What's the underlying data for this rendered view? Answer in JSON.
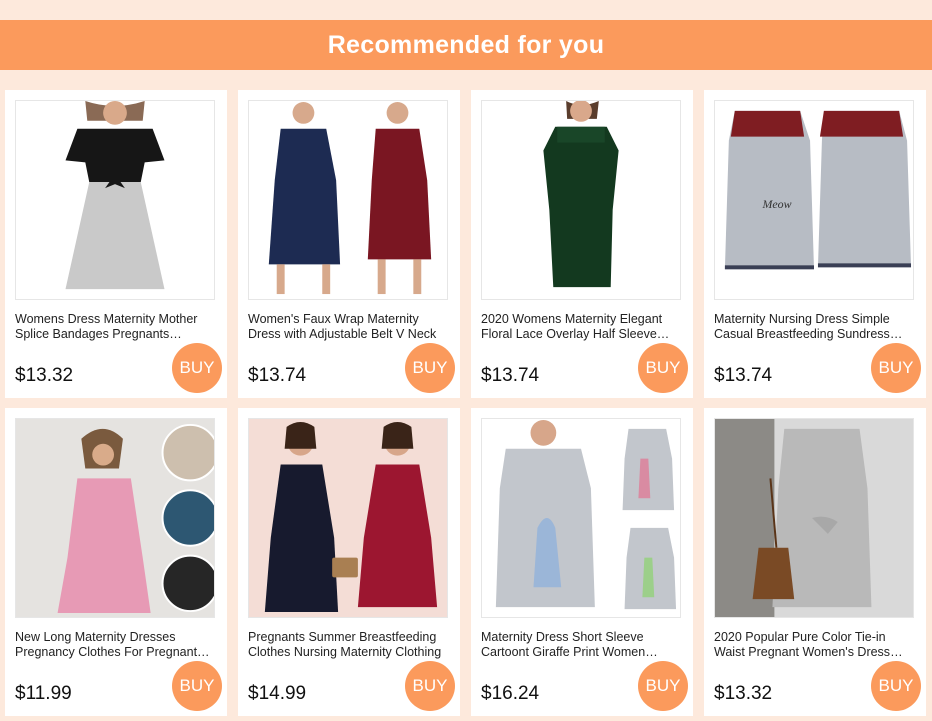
{
  "header": {
    "title": "Recommended for you"
  },
  "buy_label": "BUY",
  "colors": {
    "accent": "#fb9a5c",
    "background": "#fde9dc"
  },
  "products": [
    {
      "title": "Womens Dress Maternity Mother Splice Bandages Pregnants Breastfeeding",
      "price": "$13.32"
    },
    {
      "title": "Women's Faux Wrap Maternity Dress with Adjustable Belt V Neck",
      "price": "$13.74"
    },
    {
      "title": "2020 Womens Maternity Elegant Floral Lace Overlay Half Sleeve Dress",
      "price": "$13.74"
    },
    {
      "title": "Maternity Nursing Dress Simple Casual Breastfeeding Sundress Meow",
      "price": "$13.74"
    },
    {
      "title": "New Long Maternity Dresses Pregnancy Clothes For Pregnant Women",
      "price": "$11.99"
    },
    {
      "title": "Pregnants Summer Breastfeeding Clothes Nursing Maternity Clothing",
      "price": "$14.99"
    },
    {
      "title": "Maternity Dress Short Sleeve Cartoont Giraffe Print Women Nightgown",
      "price": "$16.24"
    },
    {
      "title": "2020 Popular Pure Color Tie-in Waist Pregnant Women's Dress Summer",
      "price": "$13.32"
    }
  ]
}
